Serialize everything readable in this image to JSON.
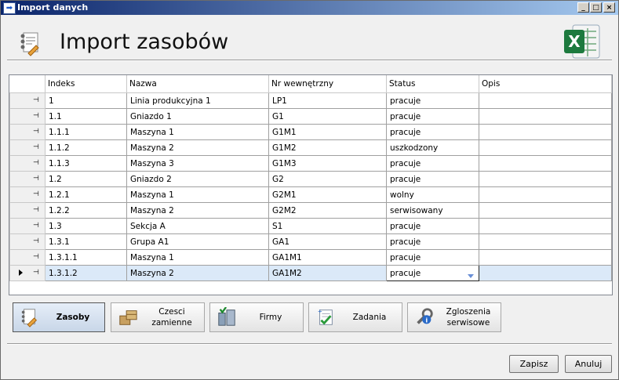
{
  "window": {
    "title": "Import danych",
    "controls": {
      "minimize": "_",
      "maximize": "□",
      "close": "×"
    }
  },
  "header": {
    "title": "Import zasobów",
    "left_icon": "assets-icon",
    "right_icon": "excel-icon"
  },
  "grid": {
    "columns": [
      "Indeks",
      "Nazwa",
      "Nr wewnętrzny",
      "Status",
      "Opis"
    ],
    "rows": [
      {
        "indeks": "1",
        "nazwa": "Linia produkcyjna 1",
        "nr": "LP1",
        "status": "pracuje",
        "opis": ""
      },
      {
        "indeks": "1.1",
        "nazwa": "Gniazdo 1",
        "nr": "G1",
        "status": "pracuje",
        "opis": ""
      },
      {
        "indeks": "1.1.1",
        "nazwa": "Maszyna 1",
        "nr": "G1M1",
        "status": "pracuje",
        "opis": ""
      },
      {
        "indeks": "1.1.2",
        "nazwa": "Maszyna 2",
        "nr": "G1M2",
        "status": "uszkodzony",
        "opis": ""
      },
      {
        "indeks": "1.1.3",
        "nazwa": "Maszyna 3",
        "nr": "G1M3",
        "status": "pracuje",
        "opis": ""
      },
      {
        "indeks": "1.2",
        "nazwa": "Gniazdo 2",
        "nr": "G2",
        "status": "pracuje",
        "opis": ""
      },
      {
        "indeks": "1.2.1",
        "nazwa": "Maszyna 1",
        "nr": "G2M1",
        "status": "wolny",
        "opis": ""
      },
      {
        "indeks": "1.2.2",
        "nazwa": "Maszyna 2",
        "nr": "G2M2",
        "status": "serwisowany",
        "opis": ""
      },
      {
        "indeks": "1.3",
        "nazwa": "Sekcja A",
        "nr": "S1",
        "status": "pracuje",
        "opis": ""
      },
      {
        "indeks": "1.3.1",
        "nazwa": "Grupa A1",
        "nr": "GA1",
        "status": "pracuje",
        "opis": ""
      },
      {
        "indeks": "1.3.1.1",
        "nazwa": "Maszyna 1",
        "nr": "GA1M1",
        "status": "pracuje",
        "opis": ""
      },
      {
        "indeks": "1.3.1.2",
        "nazwa": "Maszyna 2",
        "nr": "GA1M2",
        "status": "pracuje",
        "opis": ""
      }
    ],
    "selected_row": 11,
    "row_marker_glyph": "⊣"
  },
  "modules": [
    {
      "label": "Zasoby",
      "icon": "assets-icon",
      "active": true
    },
    {
      "label": "Czesci zamienne",
      "icon": "boxes-icon",
      "active": false
    },
    {
      "label": "Firmy",
      "icon": "buildings-icon",
      "active": false
    },
    {
      "label": "Zadania",
      "icon": "tasks-checklist-icon",
      "active": false
    },
    {
      "label": "Zgloszenia serwisowe",
      "icon": "service-wrench-icon",
      "active": false
    }
  ],
  "footer": {
    "save_label": "Zapisz",
    "cancel_label": "Anuluj"
  },
  "colors": {
    "title_gradient_start": "#0a246a",
    "title_gradient_end": "#a6caf0",
    "selected_row": "#dbe9f8",
    "excel_green": "#1d7a3e"
  }
}
